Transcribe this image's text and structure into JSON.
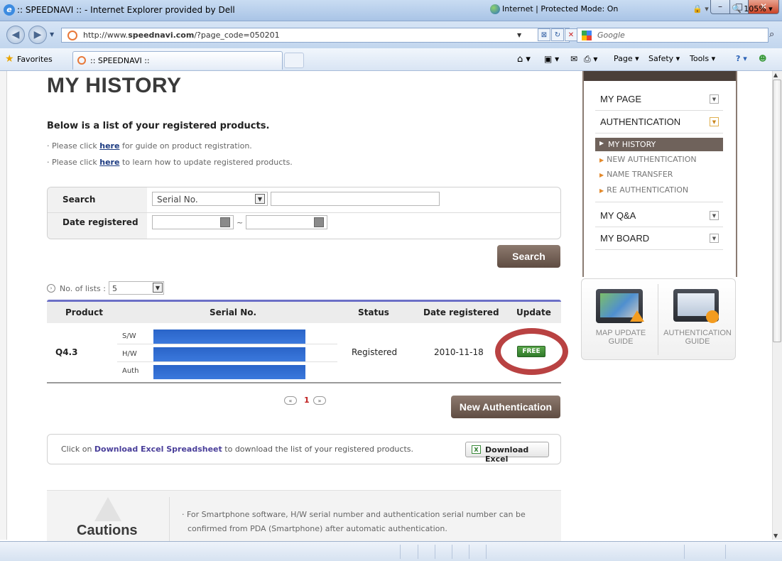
{
  "browser": {
    "window_title": ":: SPEEDNAVI :: - Internet Explorer provided by Dell",
    "url_prefix": "http://www.",
    "url_domain": "speednavi.com",
    "url_path": "/?page_code=050201",
    "search_placeholder": "Google",
    "favorites_label": "Favorites",
    "tab_title": ":: SPEEDNAVI ::",
    "commands": [
      "Page",
      "Safety",
      "Tools"
    ],
    "status_zone": "Internet | Protected Mode: On",
    "zoom": "105%"
  },
  "page": {
    "title": "MY HISTORY",
    "intro": "Below is a list of your registered products.",
    "note1_pre": "· Please click ",
    "note1_link": "here",
    "note1_post": " for guide on product registration.",
    "note2_pre": "· Please click ",
    "note2_link": "here",
    "note2_post": " to learn how to update registered products."
  },
  "search": {
    "search_label": "Search",
    "date_label": "Date registered",
    "search_type": "Serial No.",
    "keyword": "",
    "date_from": "",
    "date_sep": "~",
    "date_to": "",
    "button": "Search"
  },
  "list": {
    "count_label": "No. of lists :",
    "count_value": "5"
  },
  "table": {
    "headers": [
      "Product",
      "Serial No.",
      "Status",
      "Date registered",
      "Update"
    ],
    "rows": [
      {
        "product": "Q4.3",
        "serial_labels": [
          "S/W",
          "H/W",
          "Auth"
        ],
        "status": "Registered",
        "date": "2010-11-18",
        "update": "FREE"
      }
    ]
  },
  "pagination": {
    "prev": "«",
    "current": "1",
    "next": "»"
  },
  "actions": {
    "new_auth": "New Authentication"
  },
  "download": {
    "pre": "Click on ",
    "link": "Download Excel Spreadsheet",
    "post": " to download the list of your registered products.",
    "button": "Download Excel"
  },
  "cautions": {
    "title": "Cautions",
    "text1": "· For Smartphone software, H/W serial number and authentication serial number can be",
    "text2": "confirmed from PDA (Smartphone) after automatic authentication."
  },
  "sidebar": {
    "sections": [
      "MY PAGE",
      "AUTHENTICATION",
      "MY Q&A",
      "MY BOARD"
    ],
    "auth_items": [
      "MY HISTORY",
      "NEW AUTHENTICATION",
      "NAME TRANSFER",
      "RE AUTHENTICATION"
    ]
  },
  "guides": {
    "map_update": [
      "MAP UPDATE",
      "GUIDE"
    ],
    "authentication": [
      "AUTHENTICATION",
      "GUIDE"
    ]
  },
  "colors": {
    "accent_brown": "#6f625b",
    "table_accent": "#6b6fc7",
    "free_green": "#3f8f36",
    "highlight_red": "#b94242",
    "redaction_blue": "#2f6dd2"
  }
}
